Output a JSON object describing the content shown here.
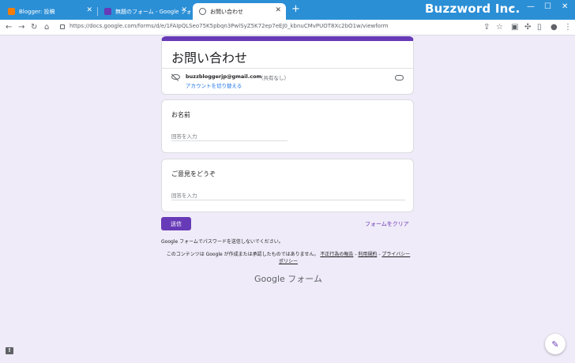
{
  "browser": {
    "brand": "Buzzword Inc.",
    "tabs": [
      {
        "label": "Blogger: 投稿",
        "icon": "blogger-icon"
      },
      {
        "label": "無題のフォーム - Google フォーム",
        "icon": "forms-icon"
      },
      {
        "label": "お問い合わせ",
        "icon": "globe-icon"
      }
    ],
    "url": "https://docs.google.com/forms/d/e/1FAIpQLSeo75K5pbqn3PwlSyZ5K72ep7eEJ0_kbnuCMvPUOT8Xc2bO1w/viewform"
  },
  "form": {
    "title": "お問い合わせ",
    "email": "buzzbloggerjp@gmail.com",
    "share_status": "（共有なし）",
    "switch_account": "アカウントを切り替える",
    "questions": [
      {
        "title": "お名前",
        "placeholder": "回答を入力"
      },
      {
        "title": "ご意見をどうぞ",
        "placeholder": "回答を入力"
      }
    ],
    "submit_label": "送信",
    "clear_label": "フォームをクリア",
    "password_note": "Google フォームでパスワードを送信しないでください。",
    "disclaimer": "このコンテンツは Google が作成または承認したものではありません。",
    "report_link": "不正行為の報告",
    "terms_link": "利用規約",
    "privacy_link": "プライバシー ポリシー",
    "footer_logo": "Google フォーム"
  },
  "colors": {
    "accent": "#673ab7",
    "titlebar": "#2b8fd6",
    "background": "#f0ebf8"
  }
}
